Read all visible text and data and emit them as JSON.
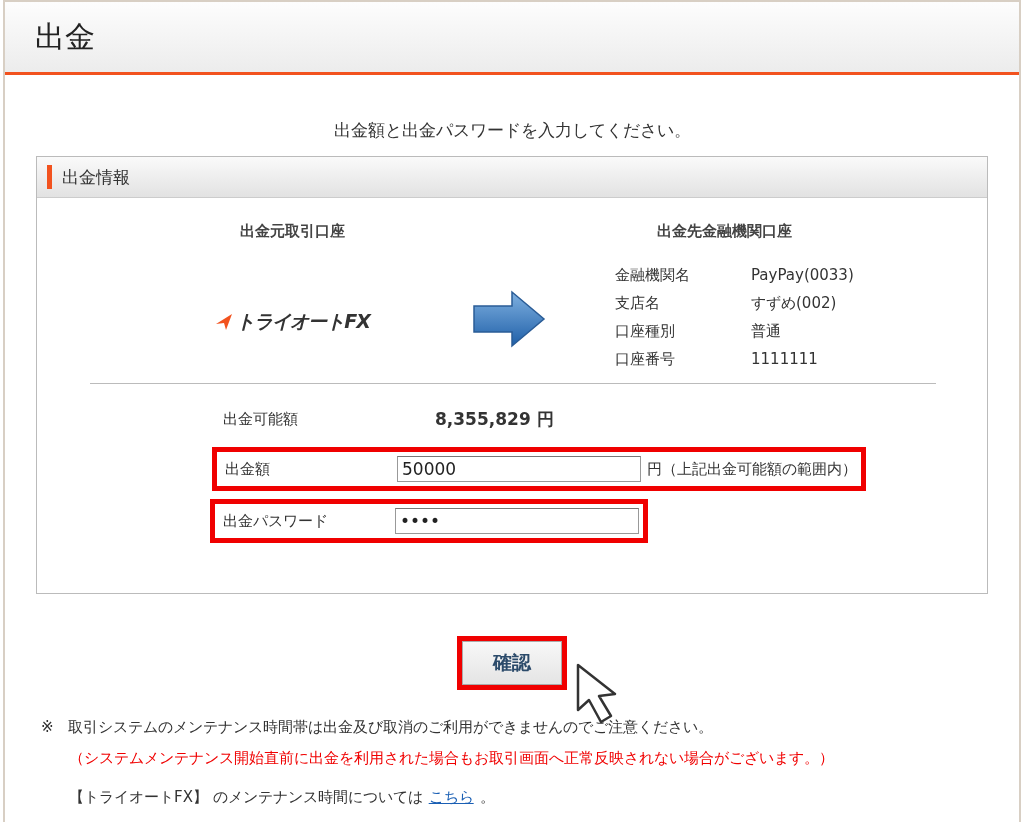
{
  "page_title": "出金",
  "instruction": "出金額と出金パスワードを入力してください。",
  "panel": {
    "title": "出金情報",
    "source": {
      "heading": "出金元取引口座",
      "logo_text": "トライオートFX"
    },
    "destination": {
      "heading": "出金先金融機関口座",
      "details": [
        {
          "label": "金融機関名",
          "value": "PayPay(0033)"
        },
        {
          "label": "支店名",
          "value": "すずめ(002)"
        },
        {
          "label": "口座種別",
          "value": "普通"
        },
        {
          "label": "口座番号",
          "value": "1111111"
        }
      ]
    },
    "available": {
      "label": "出金可能額",
      "value": "8,355,829 円"
    },
    "fields": [
      {
        "label": "出金額",
        "value": "50000",
        "suffix": "円（上記出金可能額の範囲内）",
        "highlighted": true
      },
      {
        "label": "出金パスワード",
        "value": "••••",
        "highlighted": true
      }
    ]
  },
  "confirm_button": {
    "label": "確認",
    "highlighted": true
  },
  "notes": [
    {
      "kind": "plain",
      "mark": "※",
      "text": "取引システムのメンテナンス時間帯は出金及び取消のご利用ができませんのでご注意ください。"
    },
    {
      "kind": "warning",
      "text": "（システムメンテナンス開始直前に出金を利用された場合もお取引画面へ正常反映されない場合がございます。）"
    },
    {
      "kind": "link",
      "text": "【トライオートFX】 のメンテナンス時間については",
      "link": "こちら",
      "suffix": "。"
    }
  ]
}
